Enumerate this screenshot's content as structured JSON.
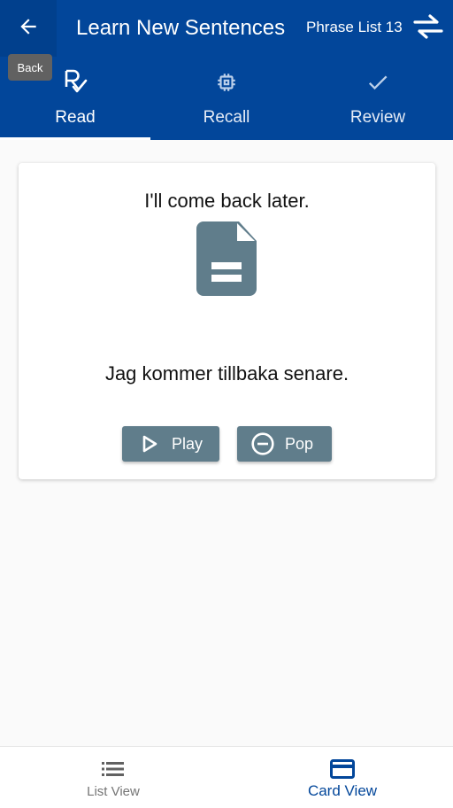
{
  "header": {
    "title": "Learn New Sentences",
    "subtitle": "Phrase List 13",
    "back_tooltip": "Back",
    "back_icon": "arrow-left-icon",
    "swap_icon": "swap-horizontal-icon"
  },
  "tabs": [
    {
      "label": "Read",
      "icon": "prescription-rx-icon",
      "active": true
    },
    {
      "label": "Recall",
      "icon": "memory-chip-icon",
      "active": false
    },
    {
      "label": "Review",
      "icon": "check-icon",
      "active": false
    }
  ],
  "card": {
    "english": "I'll come back later.",
    "translation": "Jag kommer tillbaka senare.",
    "image_icon": "document-icon",
    "play_label": "Play",
    "pop_label": "Pop"
  },
  "bottom_nav": [
    {
      "label": "List View",
      "icon": "list-icon",
      "active": false
    },
    {
      "label": "Card View",
      "icon": "card-icon",
      "active": true
    }
  ],
  "colors": {
    "primary": "#02469a",
    "button": "#607d8b",
    "background": "#fafafa"
  }
}
